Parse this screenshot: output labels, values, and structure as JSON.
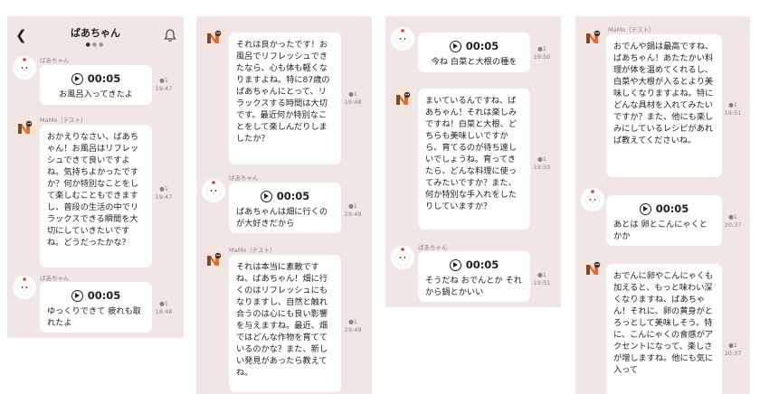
{
  "chat_title": "ばあちゃん",
  "names": {
    "grandma": "ばあちゃん",
    "mamo": "MaMo（テスト）"
  },
  "voice_duration": "00:05",
  "panels": [
    {
      "msgs": [
        {
          "text": "お風呂入ってきたよ",
          "read": "1",
          "time": "19:47"
        },
        {
          "text": "おかえりなさい、ばあちゃん！お風呂はリフレッシュできて良いですよね。気持ちよかったですか？何か特別なことをして楽しむこともできますし、普段の生活の中でリラックスできる瞬間を大切にしていきたいですね。どうだったかな？",
          "read": "1",
          "time": "19:47"
        },
        {
          "text": "ゆっくりできて 疲れも取れたよ",
          "read": "1",
          "time": "19:48"
        }
      ]
    },
    {
      "msgs": [
        {
          "text": "それは良かったです！お風呂でリフレッシュできたなら、心も体も軽くなりますよね。特に87歳のばあちゃんにとって、リラックスする時間は大切です。最近何か特別なことをして楽しんだりしましたか？",
          "read": "1",
          "time": "19:48"
        },
        {
          "text": "ばあちゃんは畑に行くのが大好きだから",
          "read": "1",
          "time": "19:49"
        },
        {
          "text": "それは本当に素敵ですね、ばあちゃん！畑に行くのはリフレッシュにもなりますし、自然と触れ合うのは心にも良い影響を与えますね。最近、畑ではどんな作物を育てているのかな？また、新しい発見があったら教えてね。",
          "read": "1",
          "time": "19:49"
        }
      ]
    },
    {
      "msgs": [
        {
          "text": "今ね 白菜と大根の種を",
          "read": "1",
          "time": "19:50"
        },
        {
          "text": "まいているんですね、ばあちゃん！それは楽しみですね！白菜と大根、どちらも美味しいですから、育てるのが待ち遠しいでしょうね。育ってきたら、どんな料理に使ってみたいですか？また、何か特別な手入れをしたりしていますか？",
          "read": "1",
          "time": "19:50"
        },
        {
          "text": "そうだね おでんとか それから鍋とかいい",
          "read": "1",
          "time": "19:51"
        }
      ]
    },
    {
      "msgs": [
        {
          "text": "おでんや鍋は最高ですね、ばあちゃん！あたたかい料理が体を温めてくれるし、白菜や大根が入るとより美味しくなりますよね。特にどんな具材を入れてみたいですか？また、他にも楽しみにしているレシピがあれば教えてくださいね。",
          "read": "1",
          "time": "19:51"
        },
        {
          "text": "あとは 卵とこんにゃくとかか",
          "read": "1",
          "time": "20:37"
        },
        {
          "text": "おでんに卵やこんにゃくも加えると、もっと味わい深くなりますね、ばあちゃん！それに、卵の黄身がとろっとして美味しそう。特に、こんにゃくの食感がアクセントになって、楽しさが増しますね。他にも気に入って",
          "read": "1",
          "time": "20:37"
        }
      ]
    }
  ]
}
